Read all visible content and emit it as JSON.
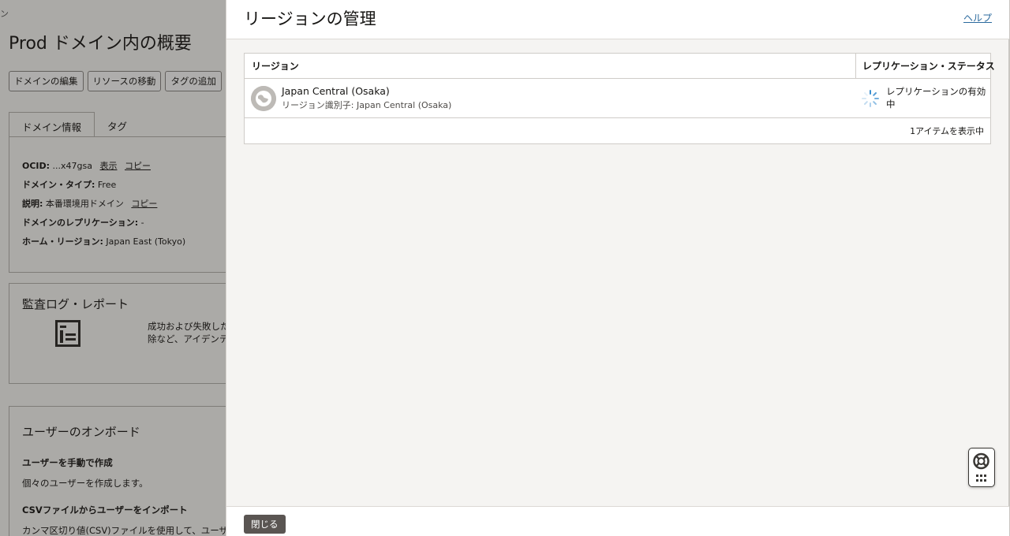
{
  "background": {
    "breadcrumb_tail": "ン",
    "title_prefix": "Prod",
    "title_rest": " ドメイン内の概要",
    "buttons": [
      "ドメインの編集",
      "リソースの移動",
      "タグの追加"
    ],
    "tabs": [
      "ドメイン情報",
      "タグ"
    ],
    "info": {
      "ocid_label": "OCID:",
      "ocid_value": " ...x47gsa",
      "show_link": "表示",
      "copy_link": "コピー",
      "type_label": "ドメイン・タイプ:",
      "type_value": " Free",
      "desc_label": "説明:",
      "desc_value": " 本番環境用ドメイン",
      "desc_copy": "コピー",
      "replication_label": "ドメインのレプリケーション:",
      "replication_value": " -",
      "home_label": "ホーム・リージョン:",
      "home_value": " Japan East (Tokyo)"
    },
    "audit": {
      "title": "監査ログ・レポート",
      "text_line1": "成功および失敗した",
      "text_line2": "除など、アイデンテ"
    },
    "onboarding": {
      "title": "ユーザーのオンボード",
      "manual_heading": "ユーザーを手動で作成",
      "manual_desc": "個々のユーザーを作成します。",
      "csv_heading": "CSVファイルからユーザーをインポート",
      "csv_desc": "カンマ区切り値(CSV)ファイルを使用して、ユーザー"
    }
  },
  "drawer": {
    "title": "リージョンの管理",
    "help_link": "ヘルプ",
    "table": {
      "columns": [
        "リージョン",
        "レプリケーション・ステータス"
      ],
      "rows": [
        {
          "region_name": "Japan Central (Osaka)",
          "region_identifier": "リージョン識別子: Japan Central (Osaka)",
          "status": "レプリケーションの有効中"
        }
      ],
      "footer": "1アイテムを表示中"
    },
    "close_button": "閉じる"
  },
  "colors": {
    "accent_link": "#2b6a9e",
    "close_button_bg": "#5a5552",
    "spinner": "#3b8fd0"
  },
  "icons": {
    "region": "globe-icon",
    "status": "loading-spinner-icon",
    "audit": "report-icon",
    "widget": "help-lifebuoy-icon"
  }
}
